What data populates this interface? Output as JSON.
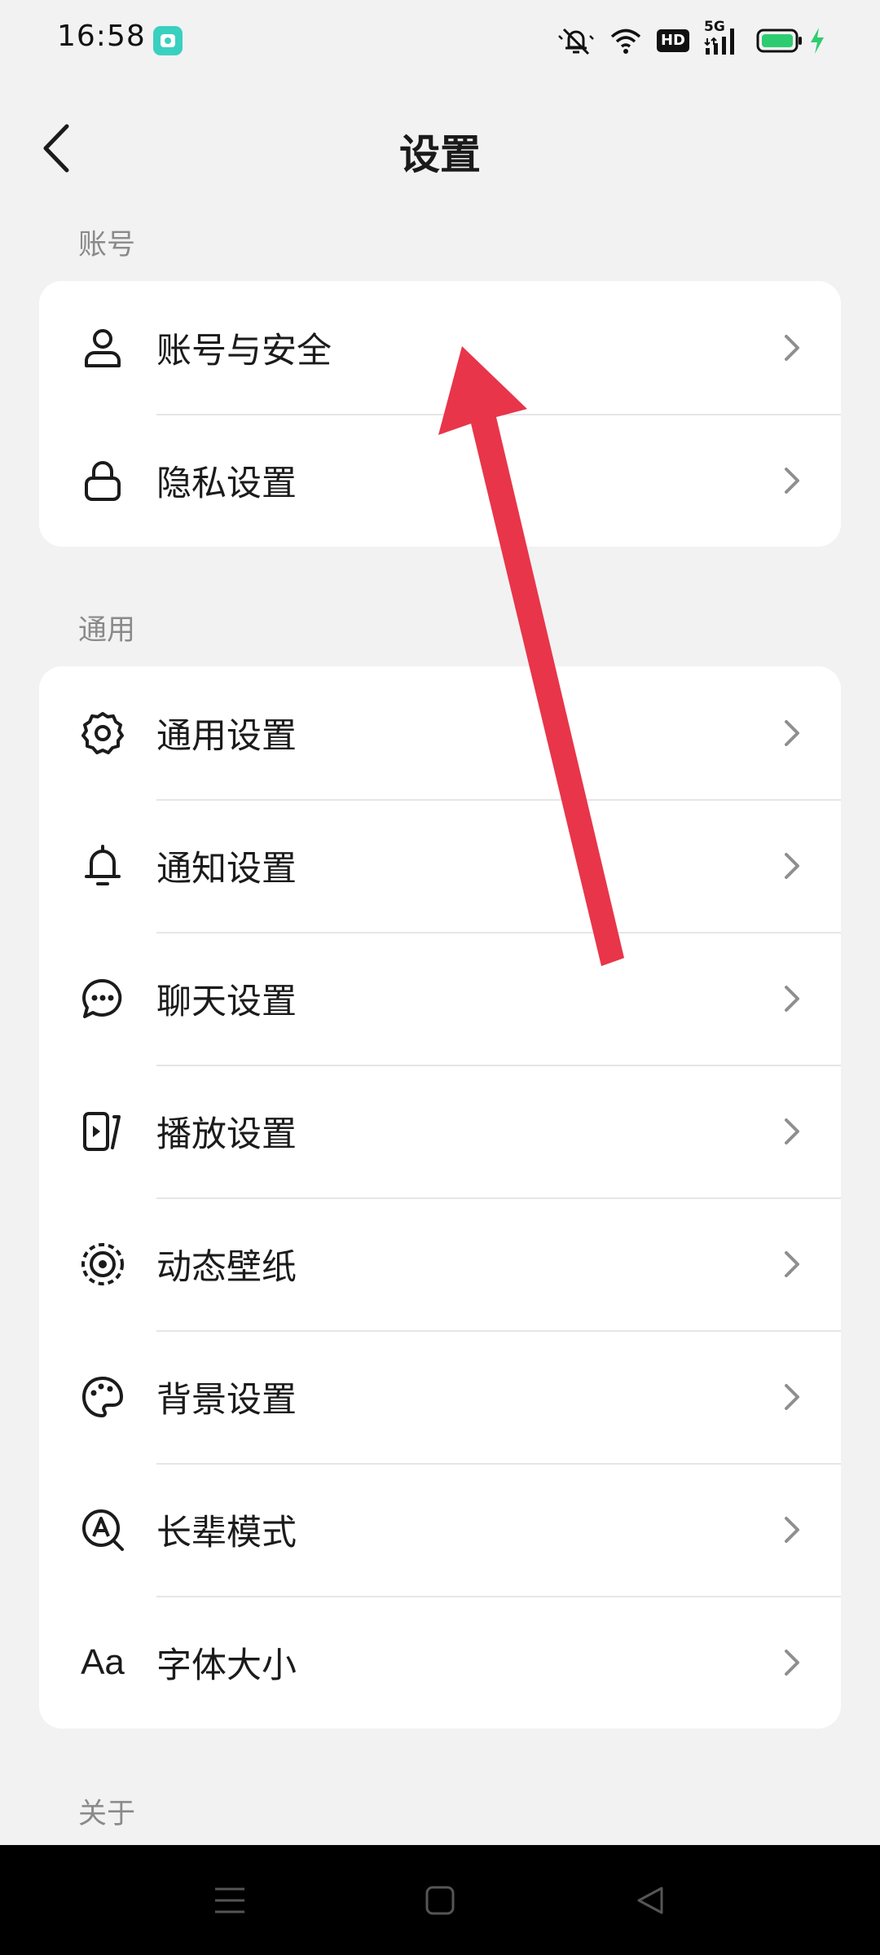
{
  "status_bar": {
    "time": "16:58",
    "hd_label": "HD",
    "network_label": "5G",
    "icons": [
      "app-badge-icon",
      "mute-icon",
      "wifi-icon",
      "hd-icon",
      "signal-icon",
      "battery-icon",
      "charging-icon"
    ],
    "battery_color": "#2ecc71"
  },
  "header": {
    "title": "设置",
    "back_icon": "back-arrow-icon"
  },
  "sections": {
    "account": {
      "label": "账号",
      "items": [
        {
          "label": "账号与安全",
          "icon": "user-icon"
        },
        {
          "label": "隐私设置",
          "icon": "lock-icon"
        }
      ]
    },
    "general": {
      "label": "通用",
      "items": [
        {
          "label": "通用设置",
          "icon": "gear-icon"
        },
        {
          "label": "通知设置",
          "icon": "bell-icon"
        },
        {
          "label": "聊天设置",
          "icon": "chat-bubble-icon"
        },
        {
          "label": "播放设置",
          "icon": "play-icon"
        },
        {
          "label": "动态壁纸",
          "icon": "live-wallpaper-icon"
        },
        {
          "label": "背景设置",
          "icon": "palette-icon"
        },
        {
          "label": "长辈模式",
          "icon": "elder-mode-icon"
        },
        {
          "label": "字体大小",
          "icon": "font-size-icon",
          "icon_text": "Aa"
        }
      ]
    },
    "about": {
      "label": "关于"
    }
  },
  "annotation": {
    "icon": "red-arrow-annotation",
    "color": "#e8354a"
  },
  "nav_bar": {
    "icons": [
      "menu-icon",
      "home-icon",
      "back-icon"
    ]
  }
}
